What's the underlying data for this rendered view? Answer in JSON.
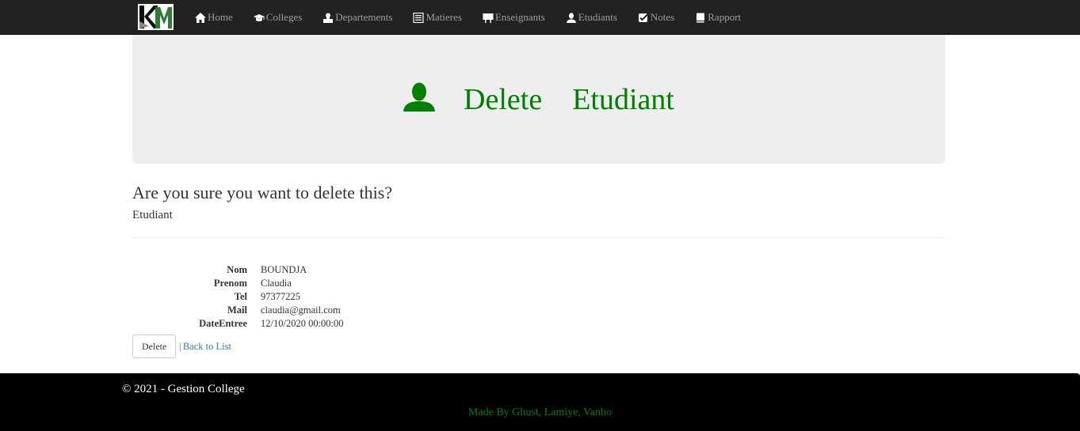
{
  "navbar": {
    "logo_icon": "km-logo",
    "items": [
      {
        "label": "Home",
        "icon": "home-icon"
      },
      {
        "label": "Colleges",
        "icon": "graduation-cap-icon"
      },
      {
        "label": "Departements",
        "icon": "id-badge-icon"
      },
      {
        "label": "Matieres",
        "icon": "list-alt-icon"
      },
      {
        "label": "Enseignants",
        "icon": "blackboard-icon"
      },
      {
        "label": "Etudiants",
        "icon": "user-icon"
      },
      {
        "label": "Notes",
        "icon": "check-icon"
      },
      {
        "label": "Rapport",
        "icon": "book-icon"
      }
    ]
  },
  "jumbotron": {
    "icon": "user-icon",
    "word1": "Delete",
    "word2": "Etudiant",
    "color": "#008000"
  },
  "page": {
    "question": "Are you sure you want to delete this?",
    "subject": "Etudiant"
  },
  "details": [
    {
      "label": "Nom",
      "value": "BOUNDJA"
    },
    {
      "label": "Prenom",
      "value": "Claudia"
    },
    {
      "label": "Tel",
      "value": "97377225"
    },
    {
      "label": "Mail",
      "value": "claudia@gmail.com"
    },
    {
      "label": "DateEntree",
      "value": "12/10/2020 00:00:00"
    }
  ],
  "actions": {
    "delete_label": "Delete",
    "separator": "|",
    "back_label": "Back to List"
  },
  "footer": {
    "copyright": "© 2021 - Gestion College",
    "made_by": "Made By Ghust, Lamiye, Vanho"
  }
}
